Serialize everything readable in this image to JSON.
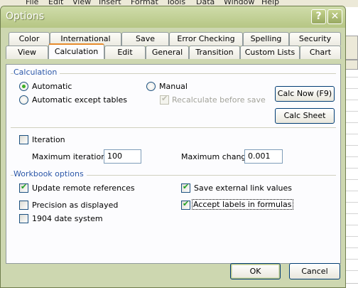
{
  "background": {
    "menu": [
      "File",
      "Edit",
      "View",
      "Insert",
      "Format",
      "Tools",
      "Data",
      "Window",
      "Help"
    ]
  },
  "dialog": {
    "title": "Options",
    "help_glyph": "?",
    "close_glyph": "✕"
  },
  "tabs_row1": [
    "Color",
    "International",
    "Save",
    "Error Checking",
    "Spelling",
    "Security"
  ],
  "tabs_row2": [
    "View",
    "Calculation",
    "Edit",
    "General",
    "Transition",
    "Custom Lists",
    "Chart"
  ],
  "active_tab": "Calculation",
  "calculation": {
    "group_label": "Calculation",
    "automatic": "Automatic",
    "automatic_except_tables": "Automatic except tables",
    "manual": "Manual",
    "recalc_before_save": "Recalculate before save",
    "calc_now_button": "Calc Now (F9)",
    "calc_sheet_button": "Calc Sheet",
    "selected_mode": "Automatic"
  },
  "iteration": {
    "label": "Iteration",
    "checked": false,
    "max_iterations_label": "Maximum iterations:",
    "max_iterations_value": "100",
    "max_change_label": "Maximum change:",
    "max_change_value": "0.001"
  },
  "workbook_options": {
    "group_label": "Workbook options",
    "update_remote_refs": "Update remote references",
    "precision_as_displayed": "Precision as displayed",
    "date_system_1904": "1904 date system",
    "save_external_link_values": "Save external link values",
    "accept_labels_in_formulas": "Accept labels in formulas"
  },
  "footer": {
    "ok_label": "OK",
    "cancel_label": "Cancel"
  },
  "colors": {
    "titlebar": "#b6c684",
    "group_label": "#2b57a8",
    "active_tab_accent": "#e68b2c",
    "check_mark": "#21a121"
  }
}
